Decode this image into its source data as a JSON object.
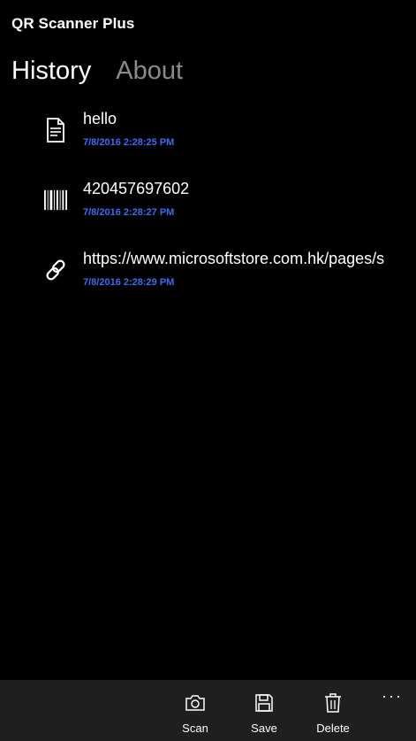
{
  "app": {
    "title": "QR Scanner Plus"
  },
  "tabs": [
    {
      "label": "History",
      "active": true
    },
    {
      "label": "About",
      "active": false
    }
  ],
  "history": [
    {
      "icon": "document-icon",
      "text": "hello",
      "timestamp": "7/8/2016 2:28:25 PM"
    },
    {
      "icon": "barcode-icon",
      "text": "420457697602",
      "timestamp": "7/8/2016 2:28:27 PM"
    },
    {
      "icon": "link-icon",
      "text": "https://www.microsoftstore.com.hk/pages/s",
      "timestamp": "7/8/2016 2:28:29 PM"
    }
  ],
  "appbar": {
    "scan_label": "Scan",
    "save_label": "Save",
    "delete_label": "Delete",
    "more_label": "···"
  },
  "colors": {
    "background": "#000000",
    "timestamp": "#3b6cf5",
    "inactive_tab": "#8a8a8a",
    "appbar": "#1f1f1f"
  }
}
